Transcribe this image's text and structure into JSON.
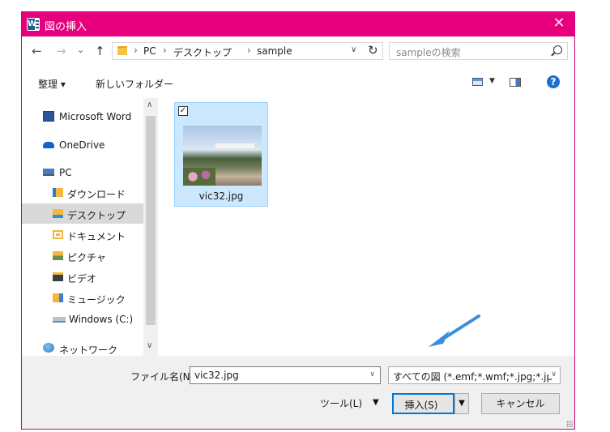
{
  "window": {
    "title": "図の挿入",
    "close_glyph": "✕"
  },
  "navigation": {
    "back_glyph": "←",
    "forward_glyph": "→",
    "recent_glyph": "⌄",
    "up_glyph": "↑",
    "breadcrumb": [
      "PC",
      "デスクトップ",
      "sample"
    ],
    "refresh_glyph": "↻",
    "search_placeholder": "sampleの検索"
  },
  "toolbar": {
    "organize": "整理 ▾",
    "new_folder": "新しいフォルダー",
    "help": "?"
  },
  "sidebar": {
    "items": [
      {
        "label": "Microsoft Word",
        "icon": "word-icon"
      },
      {
        "label": "OneDrive",
        "icon": "onedrive-icon"
      },
      {
        "label": "PC",
        "icon": "pc-icon"
      },
      {
        "label": "ダウンロード",
        "icon": "downloads-icon"
      },
      {
        "label": "デスクトップ",
        "icon": "desktop-icon",
        "selected": true
      },
      {
        "label": "ドキュメント",
        "icon": "documents-icon"
      },
      {
        "label": "ピクチャ",
        "icon": "pictures-icon"
      },
      {
        "label": "ビデオ",
        "icon": "videos-icon"
      },
      {
        "label": "ミュージック",
        "icon": "music-icon"
      },
      {
        "label": "Windows (C:)",
        "icon": "drive-icon"
      },
      {
        "label": "ネットワーク",
        "icon": "network-icon"
      }
    ]
  },
  "files": [
    {
      "name": "vic32.jpg",
      "selected": true,
      "checked": true
    }
  ],
  "footer": {
    "filename_label": "ファイル名(N):",
    "filename_value": "vic32.jpg",
    "filetype_value": "すべての図 (*.emf;*.wmf;*.jpg;*.jp",
    "tools_label": "ツール(L)",
    "insert_label": "挿入(S)",
    "cancel_label": "キャンセル"
  },
  "colors": {
    "titlebar": "#e6007e",
    "selection": "#cce8ff",
    "accent": "#0078d7",
    "arrow": "#3a8fd9"
  }
}
